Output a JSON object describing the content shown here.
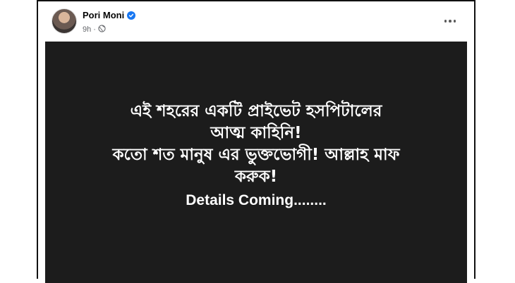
{
  "post": {
    "author": "Pori Moni",
    "verified": true,
    "time": "9h",
    "dot": "·",
    "visibility_icon": "globe-icon",
    "more_icon": "more-options-icon"
  },
  "image": {
    "background": "#1c1c1c",
    "text_color": "#ffffff",
    "lines": [
      "এই শহরের একটি প্রাইভেট হসপিটালের",
      "আত্ম কাহিনি!",
      "কতো শত মানুষ এর ভুক্তভোগী! আল্লাহ মাফ",
      "করুক!",
      "Details Coming........"
    ]
  }
}
